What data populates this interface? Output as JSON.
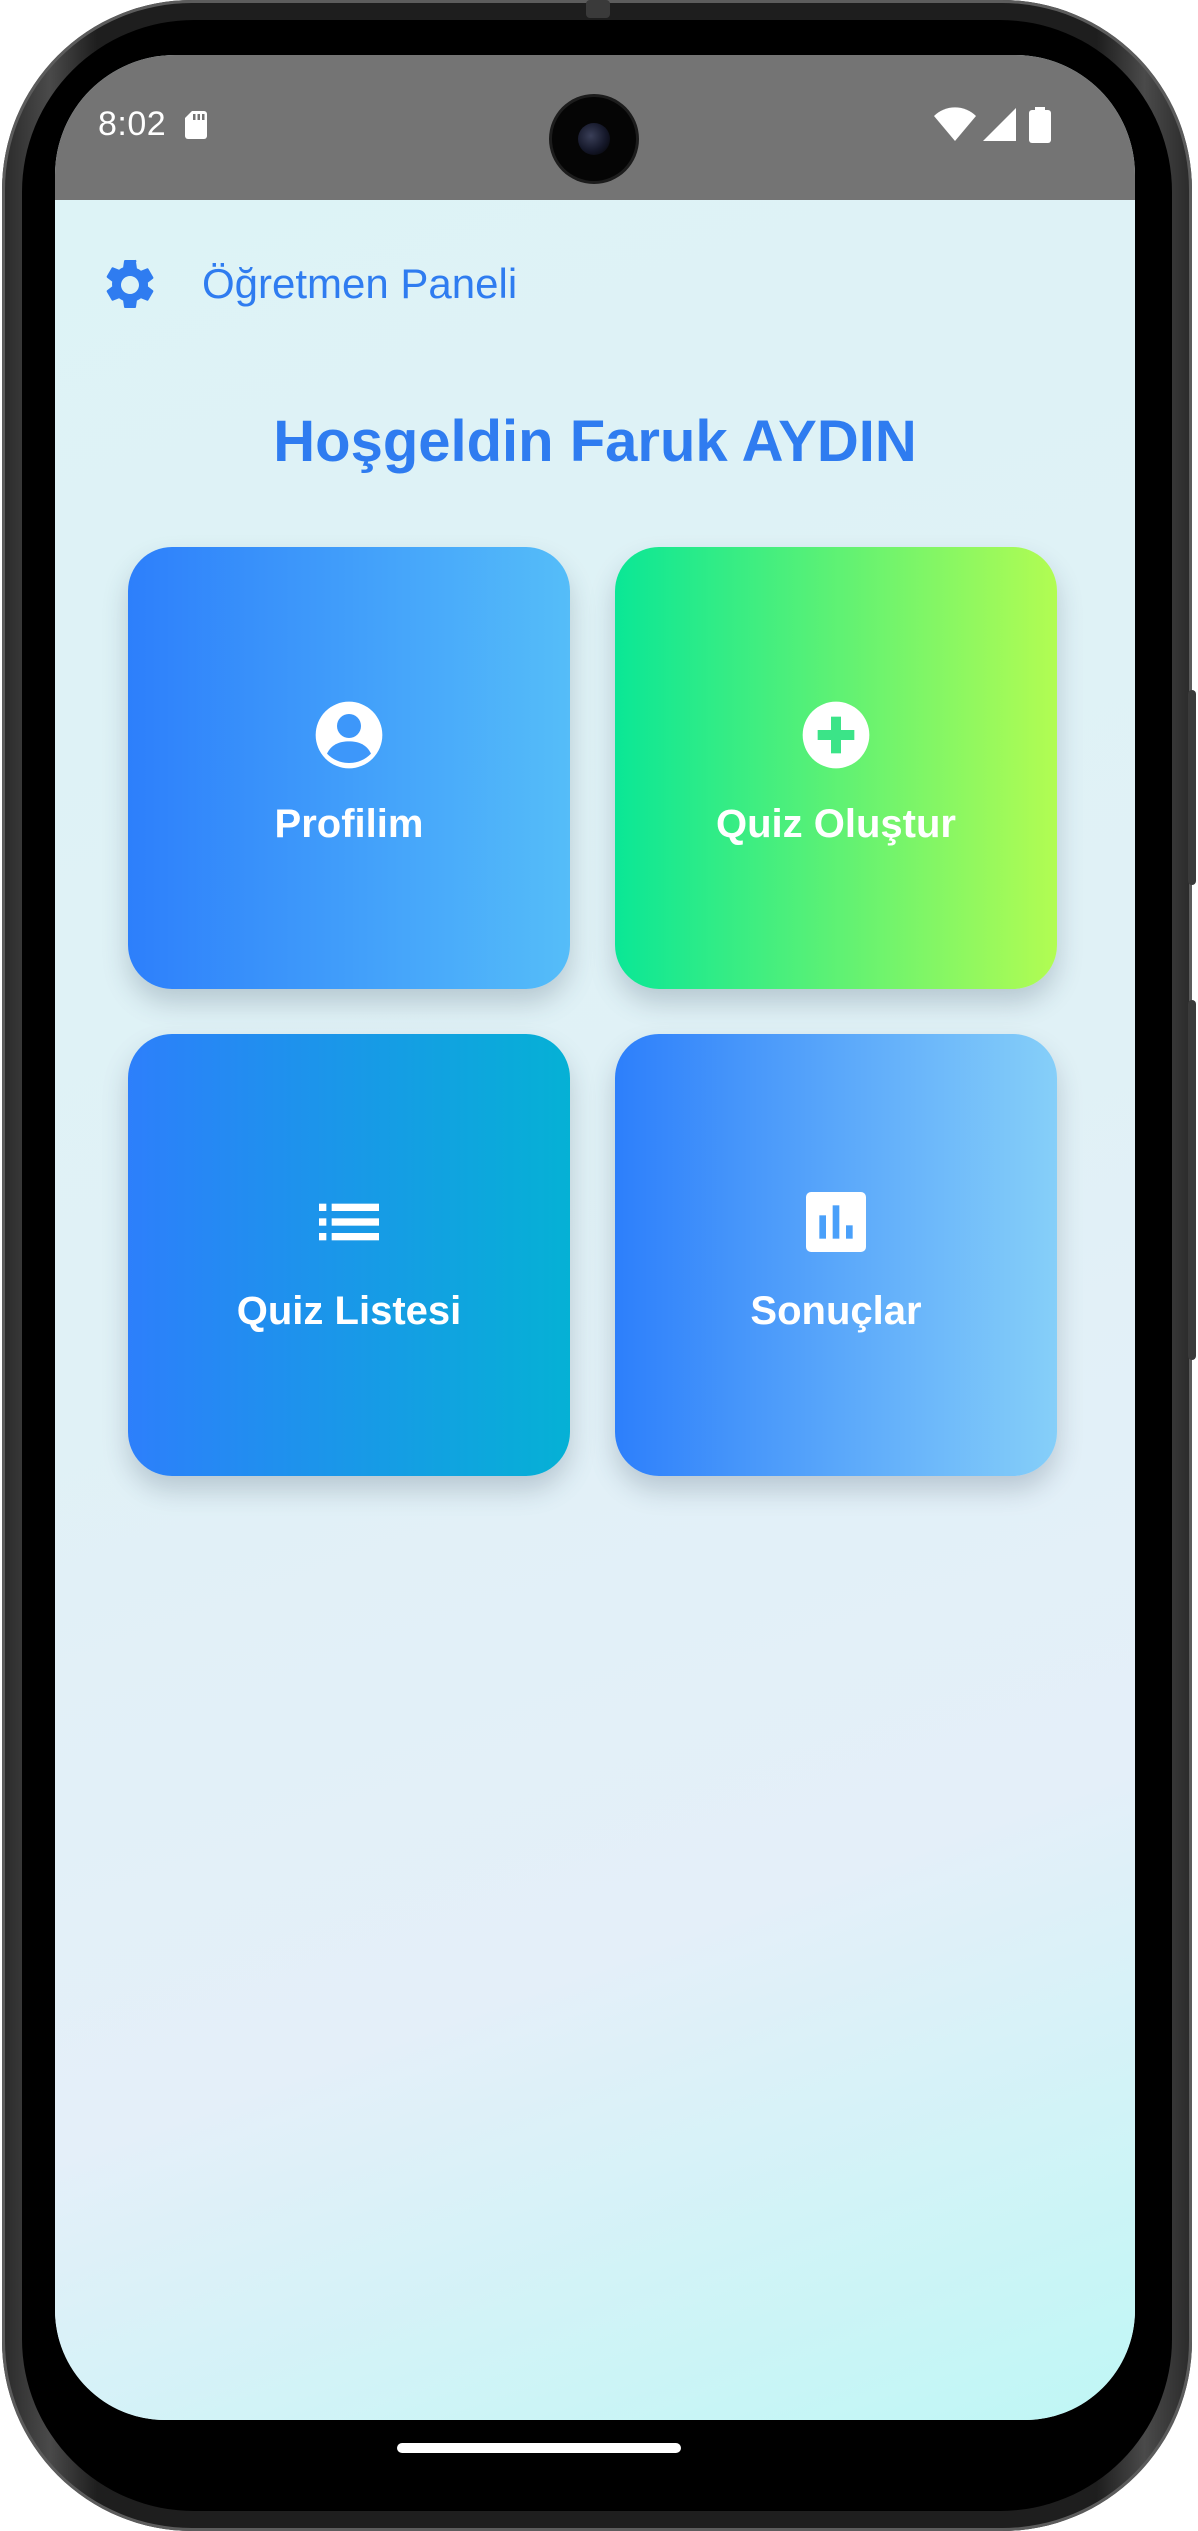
{
  "status_bar": {
    "time": "8:02",
    "icons": [
      "sd-card-icon",
      "wifi-icon",
      "cellular-signal-icon",
      "battery-icon"
    ]
  },
  "app_bar": {
    "title": "Öğretmen Paneli",
    "icon": "gear-icon"
  },
  "welcome": {
    "text": "Hoşgeldin Faruk AYDIN"
  },
  "tiles": [
    {
      "label": "Profilim",
      "icon": "account-circle-icon"
    },
    {
      "label": "Quiz Oluştur",
      "icon": "add-circle-icon"
    },
    {
      "label": "Quiz Listesi",
      "icon": "list-icon"
    },
    {
      "label": "Sonuçlar",
      "icon": "bar-chart-icon"
    }
  ],
  "colors": {
    "accent": "#2f7cf0",
    "status_bar_bg": "#747474",
    "profile_tile": [
      "#2d7ffb",
      "#55bdf9"
    ],
    "create_quiz_tile": [
      "#0ae796",
      "#b2fc52"
    ],
    "quiz_list_tile": [
      "#2d7ffb",
      "#05b1d5"
    ],
    "results_tile": [
      "#2d7ffb",
      "#86cff9"
    ]
  }
}
